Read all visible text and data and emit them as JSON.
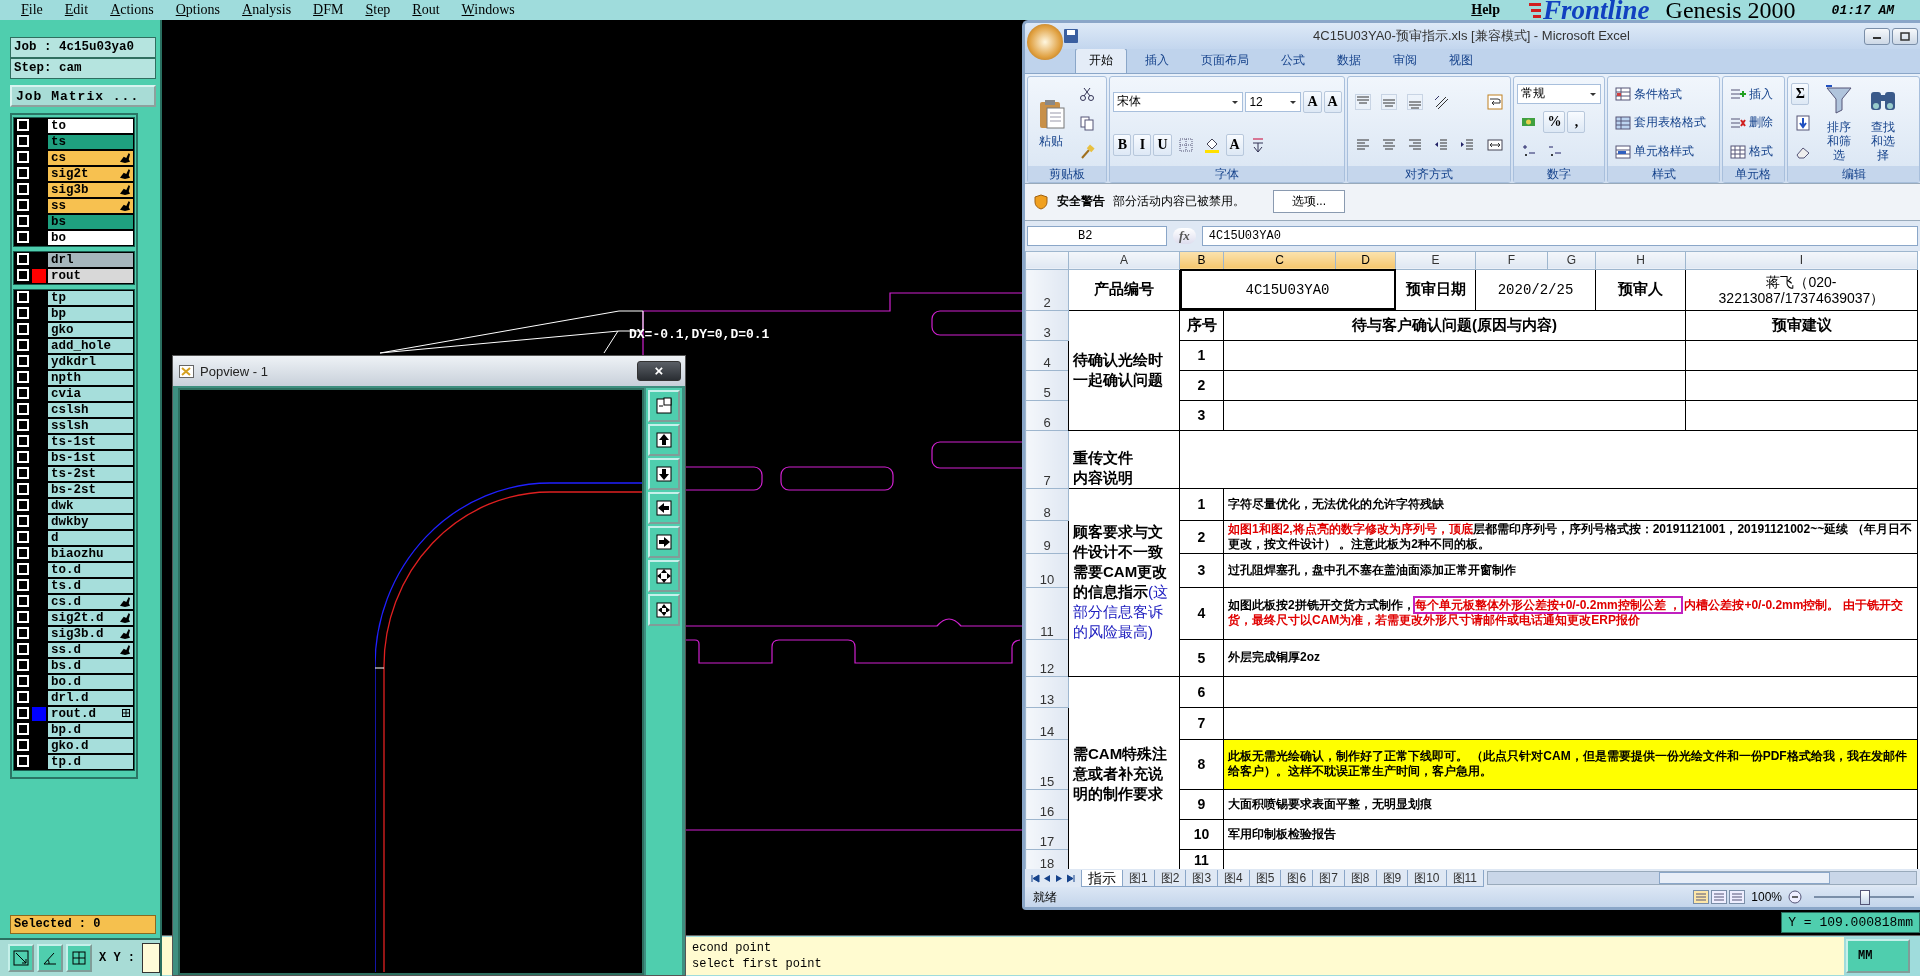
{
  "menu_bar": {
    "items": [
      "File",
      "Edit",
      "Actions",
      "Options",
      "Analysis",
      "DFM",
      "Step",
      "Rout",
      "Windows"
    ],
    "help": "Help",
    "logo": "Frontline",
    "product": "Genesis 2000",
    "time": "01:17 AM"
  },
  "sidebar": {
    "job": "Job : 4c15u03ya0",
    "step": "Step: cam",
    "matrix_button": "Job Matrix ...",
    "selected": "Selected : 0",
    "xy_label": "X Y :",
    "layer_groups": [
      {
        "layers": [
          {
            "name": "to",
            "kind": "outer",
            "checked": false,
            "pinned": false,
            "linked": false
          },
          {
            "name": "ts",
            "kind": "mask",
            "checked": false,
            "pinned": false,
            "linked": false
          },
          {
            "name": "cs",
            "kind": "signal",
            "checked": false,
            "pinned": true,
            "linked": false
          },
          {
            "name": "sig2t",
            "kind": "signal",
            "checked": false,
            "pinned": true,
            "linked": false
          },
          {
            "name": "sig3b",
            "kind": "signal",
            "checked": false,
            "pinned": true,
            "linked": false
          },
          {
            "name": "ss",
            "kind": "signal",
            "checked": false,
            "pinned": true,
            "linked": false
          },
          {
            "name": "bs",
            "kind": "mask",
            "checked": false,
            "pinned": false,
            "linked": false
          },
          {
            "name": "bo",
            "kind": "outer",
            "checked": false,
            "pinned": false,
            "linked": false
          }
        ]
      },
      {
        "layers": [
          {
            "name": "drl",
            "kind": "drill",
            "checked": false,
            "pinned": false,
            "linked": false
          },
          {
            "name": "rout",
            "kind": "rout",
            "color": "#ff0000",
            "checked": false,
            "pinned": false,
            "linked": false
          }
        ]
      },
      {
        "layers": [
          {
            "name": "tp",
            "kind": "misc",
            "checked": false,
            "pinned": false,
            "linked": false
          },
          {
            "name": "bp",
            "kind": "misc",
            "checked": false,
            "pinned": false,
            "linked": false
          },
          {
            "name": "gko",
            "kind": "misc",
            "checked": false,
            "pinned": false,
            "linked": false
          },
          {
            "name": "add_hole",
            "kind": "misc",
            "checked": false,
            "pinned": false,
            "linked": false
          },
          {
            "name": "ydkdrl",
            "kind": "misc",
            "checked": false,
            "pinned": false,
            "linked": false
          },
          {
            "name": "npth",
            "kind": "misc",
            "checked": false,
            "pinned": false,
            "linked": false
          },
          {
            "name": "cvia",
            "kind": "misc",
            "checked": false,
            "pinned": false,
            "linked": false
          },
          {
            "name": "cslsh",
            "kind": "misc",
            "checked": false,
            "pinned": false,
            "linked": false
          },
          {
            "name": "sslsh",
            "kind": "misc",
            "checked": false,
            "pinned": false,
            "linked": false
          },
          {
            "name": "ts-1st",
            "kind": "misc",
            "checked": false,
            "pinned": false,
            "linked": false
          },
          {
            "name": "bs-1st",
            "kind": "misc",
            "checked": false,
            "pinned": false,
            "linked": false
          },
          {
            "name": "ts-2st",
            "kind": "misc",
            "checked": false,
            "pinned": false,
            "linked": false
          },
          {
            "name": "bs-2st",
            "kind": "misc",
            "checked": false,
            "pinned": false,
            "linked": false
          },
          {
            "name": "dwk",
            "kind": "misc",
            "checked": false,
            "pinned": false,
            "linked": false
          },
          {
            "name": "dwkby",
            "kind": "misc",
            "checked": false,
            "pinned": false,
            "linked": false
          },
          {
            "name": "d",
            "kind": "misc",
            "checked": false,
            "pinned": false,
            "linked": false
          },
          {
            "name": "biaozhu",
            "kind": "misc",
            "checked": false,
            "pinned": false,
            "linked": false
          },
          {
            "name": "to.d",
            "kind": "misc",
            "checked": false,
            "pinned": false,
            "linked": false
          },
          {
            "name": "ts.d",
            "kind": "misc",
            "checked": false,
            "pinned": false,
            "linked": false
          },
          {
            "name": "cs.d",
            "kind": "misc",
            "checked": false,
            "pinned": true,
            "linked": false
          },
          {
            "name": "sig2t.d",
            "kind": "misc",
            "checked": false,
            "pinned": true,
            "linked": false
          },
          {
            "name": "sig3b.d",
            "kind": "misc",
            "checked": false,
            "pinned": true,
            "linked": false
          },
          {
            "name": "ss.d",
            "kind": "misc",
            "checked": false,
            "pinned": true,
            "linked": false
          },
          {
            "name": "bs.d",
            "kind": "misc",
            "checked": false,
            "pinned": false,
            "linked": false
          },
          {
            "name": "bo.d",
            "kind": "misc",
            "checked": false,
            "pinned": false,
            "linked": false
          },
          {
            "name": "drl.d",
            "kind": "misc",
            "checked": false,
            "pinned": false,
            "linked": false
          },
          {
            "name": "rout.d",
            "kind": "misc",
            "color": "#0000ff",
            "checked": false,
            "pinned": false,
            "linked": true
          },
          {
            "name": "bp.d",
            "kind": "misc",
            "checked": false,
            "pinned": false,
            "linked": false
          },
          {
            "name": "gko.d",
            "kind": "misc",
            "checked": false,
            "pinned": false,
            "linked": false
          },
          {
            "name": "tp.d",
            "kind": "misc",
            "checked": false,
            "pinned": false,
            "linked": false
          }
        ]
      }
    ]
  },
  "canvas": {
    "measure": "DX=-0.1,DY=0,D=0.1",
    "y_readout": "Y = 109.000818mm"
  },
  "popview": {
    "title": "Popview - 1",
    "close": "×"
  },
  "message_bar": {
    "lines": [
      "econd point",
      "select first point"
    ],
    "units_button": "MM"
  },
  "excel": {
    "title": "4C15U03YA0-预审指示.xls  [兼容模式] - Microsoft Excel",
    "tabs": [
      {
        "label": "开始",
        "selected": true
      },
      {
        "label": "插入",
        "selected": false
      },
      {
        "label": "页面布局",
        "selected": false
      },
      {
        "label": "公式",
        "selected": false
      },
      {
        "label": "数据",
        "selected": false
      },
      {
        "label": "审阅",
        "selected": false
      },
      {
        "label": "视图",
        "selected": false
      }
    ],
    "groups": [
      {
        "label": "剪贴板",
        "columns": [
          [
            [
              {
                "kind": "big",
                "label": "粘贴"
              }
            ]
          ],
          [
            [
              {
                "kind": "icon"
              }
            ],
            [
              {
                "kind": "icon"
              }
            ],
            [
              {
                "kind": "icon"
              }
            ]
          ]
        ]
      },
      {
        "label": "字体",
        "columns": [
          [
            [
              {
                "kind": "field",
                "value": "宋体"
              },
              {
                "kind": "field",
                "value": "12"
              },
              {
                "kind": "glyph",
                "label": "A"
              },
              {
                "kind": "glyph",
                "label": "A"
              }
            ],
            [
              {
                "kind": "glyph",
                "label": "B"
              },
              {
                "kind": "glyph",
                "label": "I"
              },
              {
                "kind": "glyph",
                "label": "U"
              },
              {
                "kind": "icon"
              },
              {
                "kind": "icon"
              },
              {
                "kind": "glyph",
                "label": "A"
              },
              {
                "kind": "icon"
              }
            ]
          ]
        ]
      },
      {
        "label": "对齐方式",
        "columns": [
          [
            [
              {
                "kind": "icon"
              },
              {
                "kind": "icon"
              },
              {
                "kind": "icon"
              },
              {
                "kind": "icon"
              }
            ],
            [
              {
                "kind": "icon"
              },
              {
                "kind": "icon"
              },
              {
                "kind": "icon"
              },
              {
                "kind": "icon"
              },
              {
                "kind": "icon"
              }
            ]
          ],
          [
            [
              {
                "kind": "icon"
              }
            ],
            [
              {
                "kind": "icon"
              }
            ]
          ]
        ]
      },
      {
        "label": "数字",
        "columns": [
          [
            [
              {
                "kind": "field",
                "value": "常规"
              }
            ],
            [
              {
                "kind": "icon"
              },
              {
                "kind": "glyph",
                "label": "%"
              },
              {
                "kind": "glyph",
                "label": ","
              }
            ],
            [
              {
                "kind": "icon"
              },
              {
                "kind": "icon"
              }
            ]
          ]
        ]
      },
      {
        "label": "样式",
        "columns": [
          [
            [
              {
                "kind": "small",
                "label": "条件格式"
              }
            ],
            [
              {
                "kind": "small",
                "label": "套用表格格式"
              }
            ],
            [
              {
                "kind": "small",
                "label": "单元格样式"
              }
            ]
          ]
        ]
      },
      {
        "label": "单元格",
        "columns": [
          [
            [
              {
                "kind": "small",
                "label": "插入"
              }
            ],
            [
              {
                "kind": "small",
                "label": "删除"
              }
            ],
            [
              {
                "kind": "small",
                "label": "格式"
              }
            ]
          ]
        ]
      },
      {
        "label": "编辑",
        "columns": [
          [
            [
              {
                "kind": "glyph",
                "label": "Σ"
              }
            ],
            [
              {
                "kind": "icon"
              }
            ],
            [
              {
                "kind": "icon"
              }
            ]
          ],
          [
            [
              {
                "kind": "big",
                "label": "排序和筛选"
              }
            ]
          ],
          [
            [
              {
                "kind": "big",
                "label": "查找和选择"
              }
            ]
          ]
        ]
      }
    ],
    "security_bar": {
      "title": "安全警告",
      "message": "部分活动内容已被禁用。",
      "button": "选项..."
    },
    "formula_bar": {
      "name_box": "B2",
      "fx": "fx",
      "value": "4C15U03YA0"
    },
    "columns": [
      {
        "label": "A",
        "selected": false
      },
      {
        "label": "B",
        "selected": true
      },
      {
        "label": "C",
        "selected": true
      },
      {
        "label": "D",
        "selected": true
      },
      {
        "label": "E",
        "selected": false
      },
      {
        "label": "F",
        "selected": false
      },
      {
        "label": "G",
        "selected": false
      },
      {
        "label": "H",
        "selected": false
      },
      {
        "label": "I",
        "selected": false
      }
    ],
    "row_numbers": [
      "2",
      "3",
      "4",
      "5",
      "6",
      "7",
      "8",
      "9",
      "10",
      "11",
      "12",
      "13",
      "14",
      "15",
      "16",
      "17",
      "18"
    ],
    "info": {
      "product_label": "产品编号",
      "product": "4C15U03YA0",
      "date_label": "预审日期",
      "date": "2020/2/25",
      "reviewer_label": "预审人",
      "reviewer": "蒋飞（020-32213087/17374639037）"
    },
    "sections": [
      {
        "kind": "questions",
        "title": "待确认光绘时一起确认问题",
        "head": {
          "number": "序号",
          "issue": "待与客户确认问题(原因与内容)",
          "advice": "预审建议"
        },
        "items": [
          {
            "number": "1"
          },
          {
            "number": "2"
          },
          {
            "number": "3"
          }
        ]
      },
      {
        "kind": "note",
        "title_lines": [
          "重传文件",
          "内容说明"
        ]
      },
      {
        "kind": "list",
        "title": "顾客要求与文件设计不一致需要CAM更改的信息指示",
        "note": "(这部分信息客诉的风险最高)",
        "items": [
          {
            "number": "1",
            "highlighted": false,
            "segments": [
              {
                "text": "字符尽量优化，无法优化的允许字符残缺",
                "kind": "plain"
              }
            ]
          },
          {
            "number": "2",
            "highlighted": false,
            "segments": [
              {
                "text": "如图1和图2,将点亮的数字修改为序列号，顶底",
                "kind": "red"
              },
              {
                "text": "层都需印序列号，序列号格式按：20191121001，20191121002~~延续 （年月日不更改，按文件设计） 。注意此板为2种不同的板。",
                "kind": "plain"
              }
            ]
          },
          {
            "number": "3",
            "highlighted": false,
            "segments": [
              {
                "text": "过孔阻焊塞孔，盘中孔不塞在盖油面添加正常开窗制作",
                "kind": "plain"
              }
            ]
          },
          {
            "number": "4",
            "highlighted": false,
            "segments": [
              {
                "text": "如图此板按2拼铣开交货方式制作，",
                "kind": "plain"
              },
              {
                "text": "每个单元板整体外形公差按+0/-0.2mm控制公差 ，",
                "kind": "boxed"
              },
              {
                "text": " 内槽公差按+0/-0.2mm控制。 由于铣开交货，最终尺寸以CAM为准，若需更改外形尺寸请邮件或电话通知更改ERP报价",
                "kind": "red"
              }
            ]
          },
          {
            "number": "5",
            "highlighted": false,
            "segments": [
              {
                "text": "外层完成铜厚2oz",
                "kind": "plain"
              }
            ]
          }
        ]
      },
      {
        "kind": "list",
        "title": "需CAM特殊注意或者补充说明的制作要求",
        "items": [
          {
            "number": "6",
            "highlighted": false
          },
          {
            "number": "7",
            "highlighted": false
          },
          {
            "number": "8",
            "highlighted": true,
            "segments": [
              {
                "text": "此板无需光绘确认，制作好了正常下线即可。 （此点只针对CAM，但是需要提供一份光绘文件和一份PDF格式给我，我在发邮件给客户）。这样不耽误正常生产时间，客户急用。",
                "kind": "plain"
              }
            ]
          },
          {
            "number": "9",
            "highlighted": false,
            "segments": [
              {
                "text": "大面积喷锡要求表面平整，无明显划痕",
                "kind": "plain"
              }
            ]
          },
          {
            "number": "10",
            "highlighted": false,
            "segments": [
              {
                "text": "军用印制板检验报告",
                "kind": "plain"
              }
            ]
          },
          {
            "number": "11",
            "highlighted": false
          }
        ]
      }
    ],
    "sheet_tabs": [
      {
        "label": "指示",
        "selected": true
      },
      {
        "label": "图1",
        "selected": false
      },
      {
        "label": "图2",
        "selected": false
      },
      {
        "label": "图3",
        "selected": false
      },
      {
        "label": "图4",
        "selected": false
      },
      {
        "label": "图5",
        "selected": false
      },
      {
        "label": "图6",
        "selected": false
      },
      {
        "label": "图7",
        "selected": false
      },
      {
        "label": "图8",
        "selected": false
      },
      {
        "label": "图9",
        "selected": false
      },
      {
        "label": "图10",
        "selected": false
      },
      {
        "label": "图11",
        "selected": false
      }
    ],
    "status": "就绪",
    "zoom": "100%",
    "zoom_slider": {
      "level": 0.5
    }
  }
}
